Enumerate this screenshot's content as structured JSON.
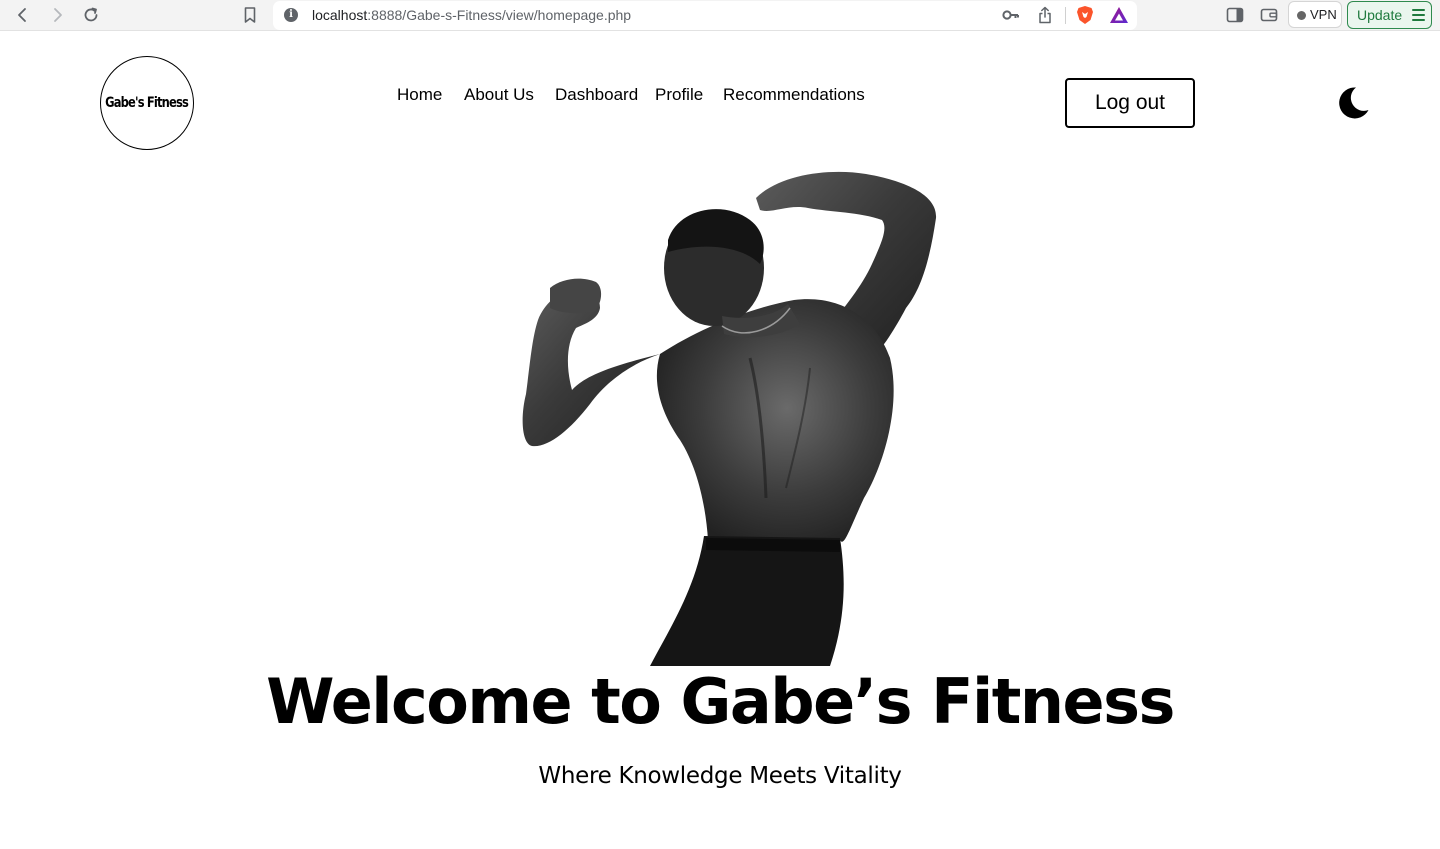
{
  "browser": {
    "url_host": "localhost",
    "url_path": ":8888/Gabe-s-Fitness/view/homepage.php",
    "vpn_label": "VPN",
    "update_label": "Update",
    "colors": {
      "update_accent": "#1f7a3e",
      "brave_orange": "#fb542b"
    }
  },
  "site": {
    "logo_text": "Gabe's Fitness",
    "nav": {
      "home": "Home",
      "about": "About Us",
      "dashboard": "Dashboard",
      "profile": "Profile",
      "recommendations": "Recommendations"
    },
    "logout_label": "Log out",
    "theme_toggle_icon": "moon-icon"
  },
  "hero": {
    "title": "Welcome to Gabe’s Fitness",
    "subtitle": "Where Knowledge Meets Vitality",
    "image_icon": "bodybuilder-photo"
  }
}
